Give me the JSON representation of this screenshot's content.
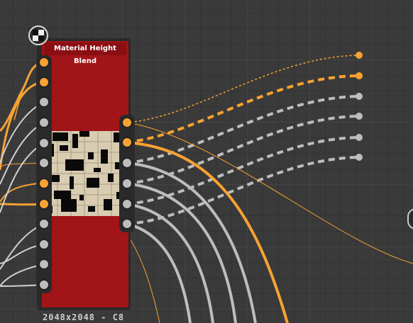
{
  "graph": {
    "node": {
      "title": "Material Height Blend",
      "resolution": "2048x2048 - C8",
      "body_color": "#a11417",
      "input_sockets": [
        "orange",
        "orange",
        "gray",
        "gray",
        "gray",
        "gray",
        "orange",
        "orange",
        "gray",
        "gray",
        "gray",
        "gray"
      ],
      "output_sockets": [
        "orange",
        "orange",
        "gray",
        "gray",
        "gray",
        "gray"
      ],
      "icon": "checker-icon"
    },
    "colors": {
      "orange": "#f7a233",
      "gray": "#bdbdbd",
      "background": "#3a3a3a"
    }
  }
}
